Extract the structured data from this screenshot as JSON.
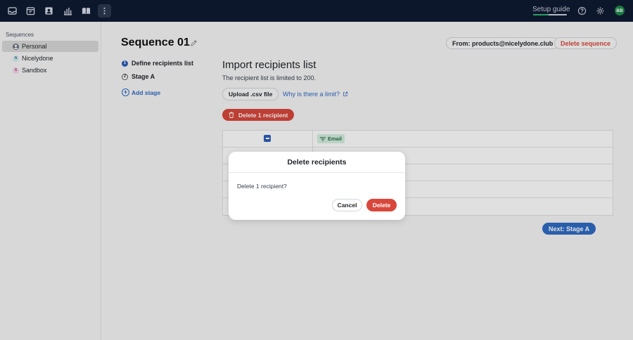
{
  "topbar": {
    "icons": [
      "inbox-icon",
      "calendar-icon",
      "contacts-icon",
      "analytics-icon",
      "book-icon",
      "more-vertical-icon"
    ],
    "setup_guide_label": "Setup guide",
    "setup_progress": 0.45,
    "help_icon": "help-icon",
    "settings_icon": "gear-icon",
    "avatar_initials": "BB"
  },
  "sidebar": {
    "title": "Sequences",
    "items": [
      {
        "label": "Personal",
        "badge": "",
        "selected": true
      },
      {
        "label": "Nicelydone",
        "badge": "N",
        "selected": false
      },
      {
        "label": "Sandbox",
        "badge": "S",
        "selected": false
      }
    ]
  },
  "sequence": {
    "title": "Sequence 01",
    "steps": [
      {
        "num": "1",
        "label": "Define recipients list"
      },
      {
        "num": "2",
        "label": "Stage A"
      }
    ],
    "add_stage_label": "Add stage"
  },
  "header_actions": {
    "from_label": "From: products@nicelydone.club",
    "delete_sequence_label": "Delete sequence"
  },
  "import": {
    "title": "Import recipients list",
    "subtitle": "The recipient list is limited to 200.",
    "upload_label": "Upload .csv file",
    "why_link": "Why is there a limit?",
    "delete_recipients_label": "Delete 1 recipient"
  },
  "table": {
    "columns": [
      "Email"
    ]
  },
  "next_label": "Next: Stage A",
  "modal": {
    "title": "Delete recipients",
    "message": "Delete 1 recipient?",
    "cancel_label": "Cancel",
    "delete_label": "Delete"
  },
  "colors": {
    "topbar": "#0f1b33",
    "accent": "#2f6bc4",
    "danger": "#d9473b"
  }
}
